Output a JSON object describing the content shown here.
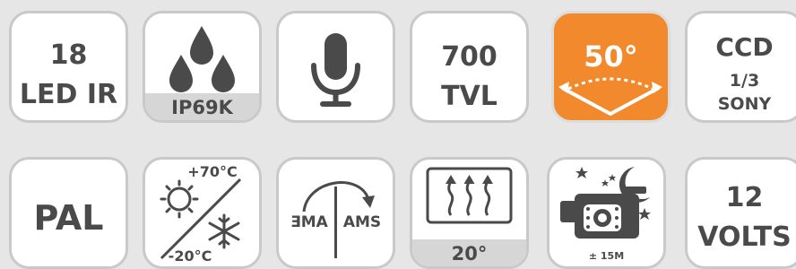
{
  "colors": {
    "tile_bg": "#ffffff",
    "tile_border": "#c9c9c9",
    "accent": "#f28a2d",
    "icon": "#4a4a4a",
    "band": "#d6d6d6"
  },
  "row1": {
    "led": {
      "count": "18",
      "label": "LED IR"
    },
    "water": {
      "icon": "water-drops-icon",
      "label": "IP69K"
    },
    "mic": {
      "icon": "microphone-icon"
    },
    "tvl": {
      "value": "700",
      "unit": "TVL"
    },
    "angle": {
      "value": "50°",
      "icon": "viewing-angle-icon"
    },
    "ccd": {
      "title": "CCD",
      "size": "1/3",
      "brand": "SONY"
    }
  },
  "row2": {
    "pal": {
      "label": "PAL"
    },
    "temp": {
      "high": "+70°C",
      "low": "-20°C",
      "icon": "sun-snowflake-icon"
    },
    "mirror": {
      "left": "ƎMA",
      "right": "AMS",
      "icon": "mirror-arrow-icon"
    },
    "heat": {
      "icon": "heater-icon",
      "label": "20°"
    },
    "night": {
      "icon": "night-vision-camera-icon",
      "range": "± 15M"
    },
    "volts": {
      "value": "12",
      "unit": "VOLTS"
    }
  }
}
